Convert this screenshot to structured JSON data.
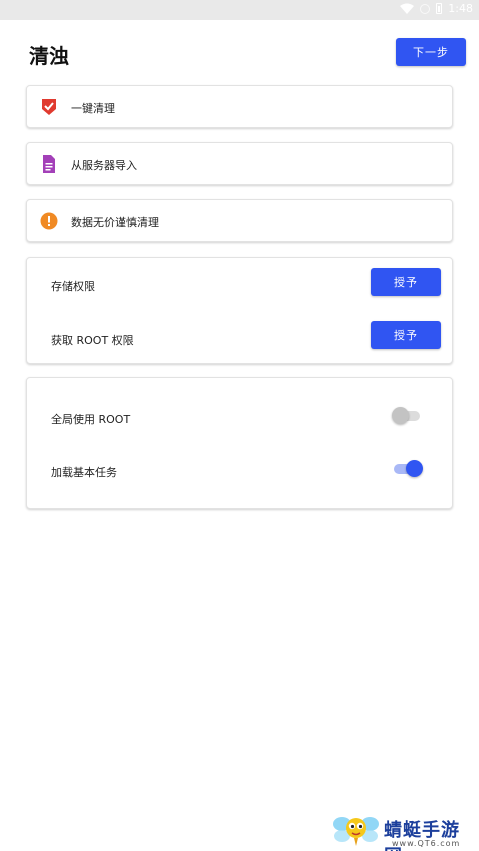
{
  "status_bar": {
    "time": "1:48"
  },
  "header": {
    "title": "清浊",
    "next_label": "下一步"
  },
  "actions": [
    {
      "label": "一键清理",
      "icon": "shield-check-icon",
      "color": "#e03a2f"
    },
    {
      "label": "从服务器导入",
      "icon": "document-icon",
      "color": "#a340b8"
    },
    {
      "label": "数据无价谨慎清理",
      "icon": "warning-icon",
      "color": "#f08a24"
    }
  ],
  "permissions": {
    "storage_label": "存储权限",
    "root_label": "获取 ROOT 权限",
    "grant_label": "授予"
  },
  "settings": {
    "global_root_label": "全局使用 ROOT",
    "global_root_on": false,
    "load_basic_tasks_label": "加载基本任务",
    "load_basic_tasks_on": true
  },
  "colors": {
    "accent": "#3055f2",
    "accent_light": "#a9b8f6"
  },
  "watermark": {
    "name": "蜻蜓手游网",
    "url": "www.QT6.com"
  }
}
